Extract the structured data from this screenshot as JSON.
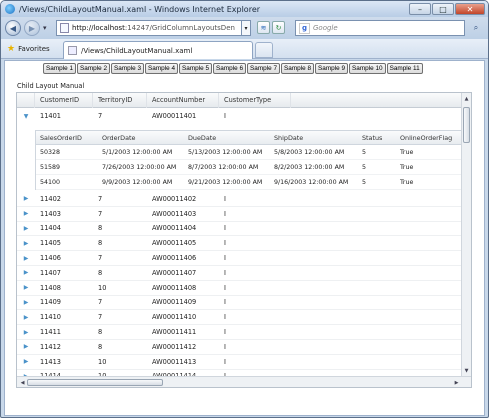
{
  "window": {
    "title": "/Views/ChildLayoutManual.xaml - Windows Internet Explorer",
    "minimize_glyph": "–",
    "maximize_glyph": "□",
    "close_glyph": "✕"
  },
  "nav": {
    "back_glyph": "◀",
    "forward_glyph": "▶",
    "dropdown_glyph": "▾",
    "address_host": "http://localhost",
    "address_path": ":14247/GridColumnLayoutsDen",
    "search_placeholder": "Google",
    "search_engine_letter": "g",
    "search_icon_glyph": "⌕"
  },
  "favorites": {
    "label": "Favorites",
    "star": "★",
    "tab_title": "/Views/ChildLayoutManual.xaml"
  },
  "samples": [
    "Sample 1",
    "Sample 2",
    "Sample 3",
    "Sample 4",
    "Sample 5",
    "Sample 6",
    "Sample 7",
    "Sample 8",
    "Sample 9",
    "Sample 10",
    "Sample 11"
  ],
  "grid": {
    "label": "Child Layout Manual",
    "columns": [
      "CustomerID",
      "TerritoryID",
      "AccountNumber",
      "CustomerType"
    ],
    "expanded_row": {
      "customer_id": "11401",
      "territory_id": "7",
      "account": "AW00011401",
      "type": "I"
    },
    "child": {
      "columns": [
        "SalesOrderID",
        "OrderDate",
        "DueDate",
        "ShipDate",
        "Status",
        "OnlineOrderFlag"
      ],
      "rows": [
        [
          "50328",
          "5/1/2003 12:00:00 AM",
          "5/13/2003 12:00:00 AM",
          "5/8/2003 12:00:00 AM",
          "5",
          "True"
        ],
        [
          "51589",
          "7/26/2003 12:00:00 AM",
          "8/7/2003 12:00:00 AM",
          "8/2/2003 12:00:00 AM",
          "5",
          "True"
        ],
        [
          "54100",
          "9/9/2003 12:00:00 AM",
          "9/21/2003 12:00:00 AM",
          "9/16/2003 12:00:00 AM",
          "5",
          "True"
        ]
      ]
    },
    "rows": [
      [
        "11402",
        "7",
        "AW00011402",
        "I"
      ],
      [
        "11403",
        "7",
        "AW00011403",
        "I"
      ],
      [
        "11404",
        "8",
        "AW00011404",
        "I"
      ],
      [
        "11405",
        "8",
        "AW00011405",
        "I"
      ],
      [
        "11406",
        "7",
        "AW00011406",
        "I"
      ],
      [
        "11407",
        "8",
        "AW00011407",
        "I"
      ],
      [
        "11408",
        "10",
        "AW00011408",
        "I"
      ],
      [
        "11409",
        "7",
        "AW00011409",
        "I"
      ],
      [
        "11410",
        "7",
        "AW00011410",
        "I"
      ],
      [
        "11411",
        "8",
        "AW00011411",
        "I"
      ],
      [
        "11412",
        "8",
        "AW00011412",
        "I"
      ],
      [
        "11413",
        "10",
        "AW00011413",
        "I"
      ],
      [
        "11414",
        "10",
        "AW00011414",
        "I"
      ]
    ]
  },
  "colors": {
    "accent": "#4a92c9",
    "chrome": "#c8d8ea"
  }
}
